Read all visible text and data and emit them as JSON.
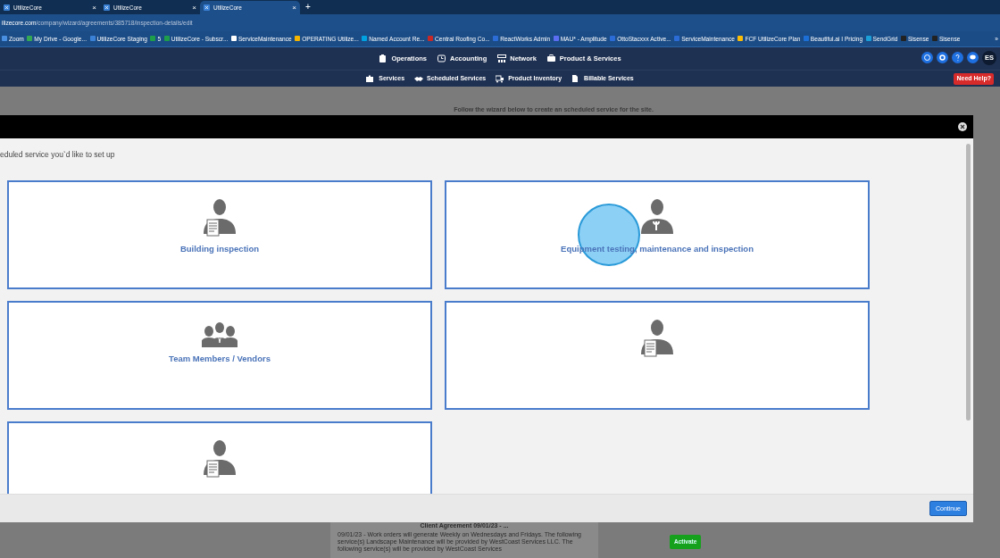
{
  "browser": {
    "tabs": [
      {
        "title": "UtilizeCore",
        "close": "×",
        "selected": false
      },
      {
        "title": "UtilizeCore",
        "close": "×",
        "selected": false
      },
      {
        "title": "UtilizeCore",
        "close": "×",
        "selected": true
      }
    ],
    "new_tab": "+",
    "url_host": "ilizecore.com",
    "url_path": "/company/wizard/agreements/385718/inspection-details/edit",
    "bookmarks": [
      {
        "label": "Zoom"
      },
      {
        "label": "My Drive - Google..."
      },
      {
        "label": "UtilizeCore Staging"
      },
      {
        "label": "5"
      },
      {
        "label": "UtilizeCore - Subscr..."
      },
      {
        "label": "ServiceMaintenance"
      },
      {
        "label": "OPERATING Utilize..."
      },
      {
        "label": "Named Account Re..."
      },
      {
        "label": "Central Roofing Co..."
      },
      {
        "label": "ReactWorks Admin"
      },
      {
        "label": "MAU* - Amplitude"
      },
      {
        "label": "OttoStacxxx Active..."
      },
      {
        "label": "ServiceMaintenance"
      },
      {
        "label": "FCF UtilizeCore Plan"
      },
      {
        "label": "Beautiful.ai I Pricing"
      },
      {
        "label": "SendGrid"
      },
      {
        "label": "Sisense"
      },
      {
        "label": "Sisense"
      }
    ],
    "more_bookmarks": "»"
  },
  "app_nav": {
    "main": [
      {
        "label": "Operations"
      },
      {
        "label": "Accounting"
      },
      {
        "label": "Network"
      },
      {
        "label": "Product & Services"
      }
    ],
    "sub": [
      {
        "label": "Services"
      },
      {
        "label": "Scheduled Services"
      },
      {
        "label": "Product Inventory"
      },
      {
        "label": "Billable Services"
      }
    ],
    "avatar": "ES",
    "help": "Need Help?"
  },
  "background_page": {
    "instruction": "Follow the wizard below to create an scheduled service for the site.",
    "agreement_title": "Client Agreement",
    "agreement_date": "09/01/23 - ...",
    "agreement_text": "09/01/23 - Work orders will generate Weekly on Wednesdays and Fridays. The following service(s) Landscape Maintenance will be provided by WestCoast Services LLC. The following service(s) will be provided by WestCoast Services",
    "activate": "Activate"
  },
  "modal": {
    "prompt": "eduled service you`d like to set up",
    "options": [
      {
        "label": "Building inspection",
        "kind": "inspector"
      },
      {
        "label": "Equipment testing, maintenance and inspection",
        "kind": "mechanic"
      },
      {
        "label": "Team Members / Vendors",
        "kind": "team"
      },
      {
        "kind": "inspector"
      },
      {
        "kind": "inspector"
      }
    ],
    "continue": "Continue"
  }
}
